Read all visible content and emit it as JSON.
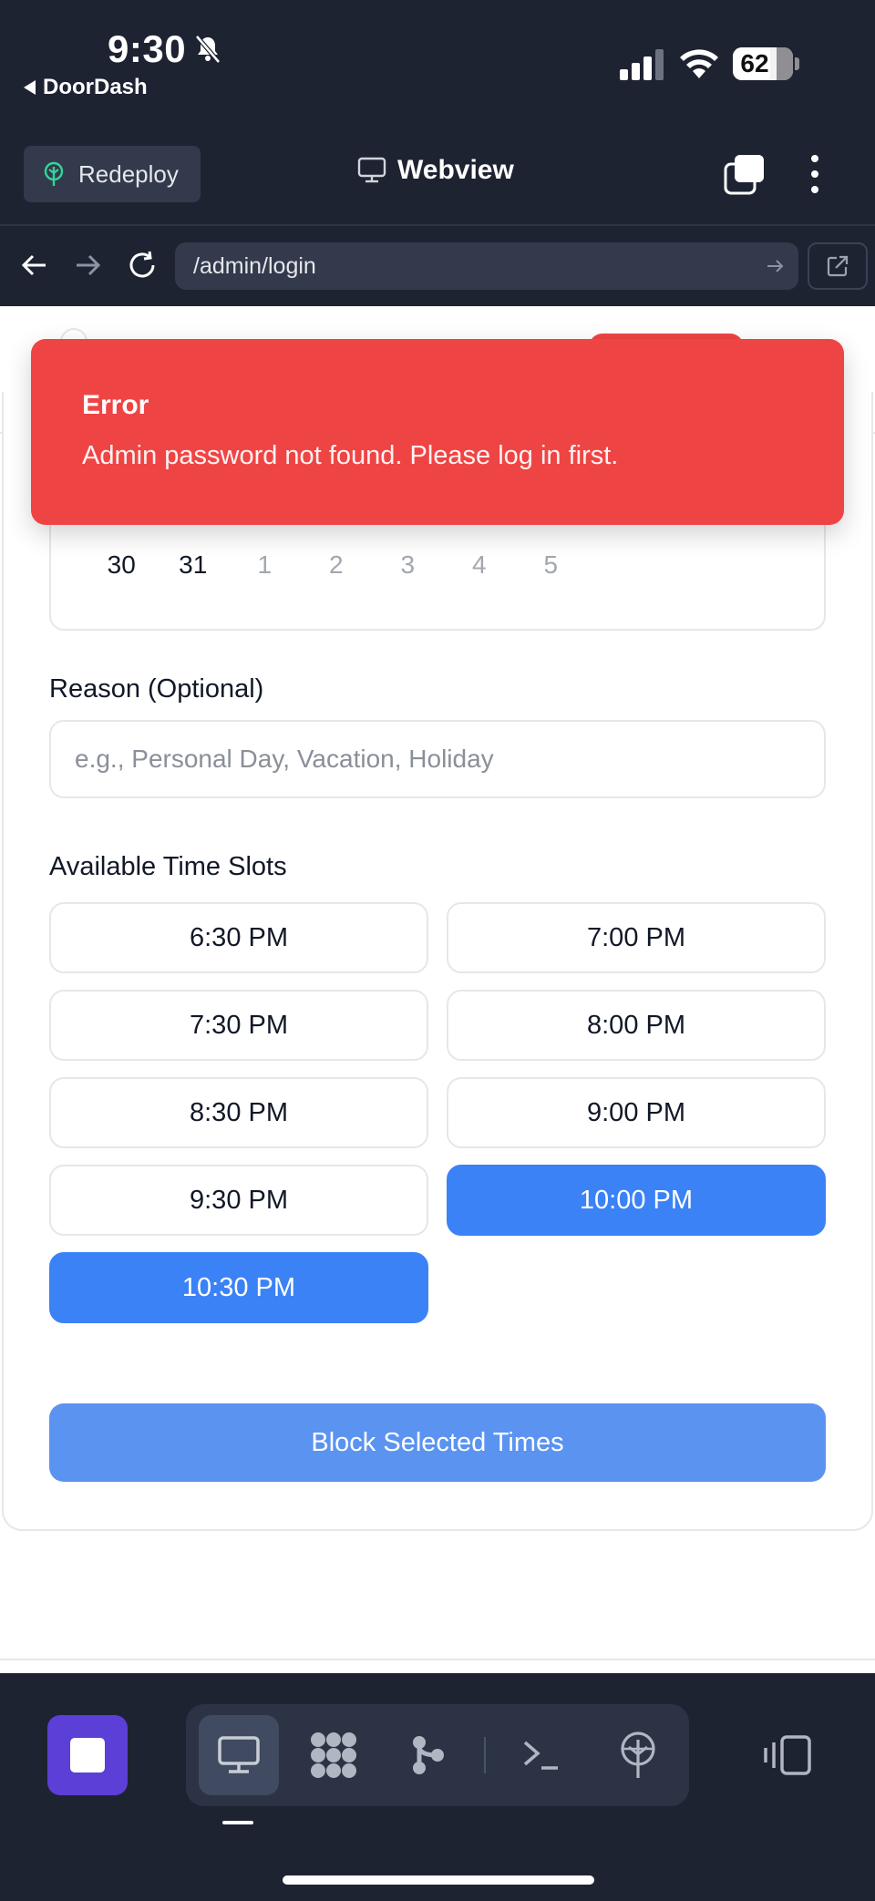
{
  "status_bar": {
    "time": "9:30",
    "back_app": "DoorDash",
    "battery_percent": "62",
    "battery_level": 0.62
  },
  "app_header": {
    "redeploy_label": "Redeploy",
    "title": "Webview"
  },
  "browser_bar": {
    "url": "/admin/login"
  },
  "toast": {
    "title": "Error",
    "message": "Admin password not found. Please log in first."
  },
  "calendar": {
    "days": [
      {
        "label": "30",
        "muted": false
      },
      {
        "label": "31",
        "muted": false
      },
      {
        "label": "1",
        "muted": true
      },
      {
        "label": "2",
        "muted": true
      },
      {
        "label": "3",
        "muted": true
      },
      {
        "label": "4",
        "muted": true
      },
      {
        "label": "5",
        "muted": true
      }
    ]
  },
  "reason": {
    "label": "Reason (Optional)",
    "placeholder": "e.g., Personal Day, Vacation, Holiday",
    "value": ""
  },
  "time_slots": {
    "label": "Available Time Slots",
    "slots": [
      {
        "label": "6:30 PM",
        "selected": false
      },
      {
        "label": "7:00 PM",
        "selected": false
      },
      {
        "label": "7:30 PM",
        "selected": false
      },
      {
        "label": "8:00 PM",
        "selected": false
      },
      {
        "label": "8:30 PM",
        "selected": false
      },
      {
        "label": "9:00 PM",
        "selected": false
      },
      {
        "label": "9:30 PM",
        "selected": false
      },
      {
        "label": "10:00 PM",
        "selected": true
      },
      {
        "label": "10:30 PM",
        "selected": true
      }
    ]
  },
  "block_button": {
    "label": "Block Selected Times"
  },
  "toolbar": {
    "items": [
      {
        "icon": "monitor-icon",
        "active": true
      },
      {
        "icon": "grid-blob-icon",
        "active": false
      },
      {
        "icon": "branch-icon",
        "active": false
      },
      {
        "icon": "terminal-icon",
        "active": false
      },
      {
        "icon": "deploy-tree-icon",
        "active": false
      }
    ]
  },
  "colors": {
    "chrome_bg": "#1e2332",
    "error_red": "#ef4444",
    "accent_blue": "#3b82f6",
    "stop_purple": "#5b3fd6"
  }
}
